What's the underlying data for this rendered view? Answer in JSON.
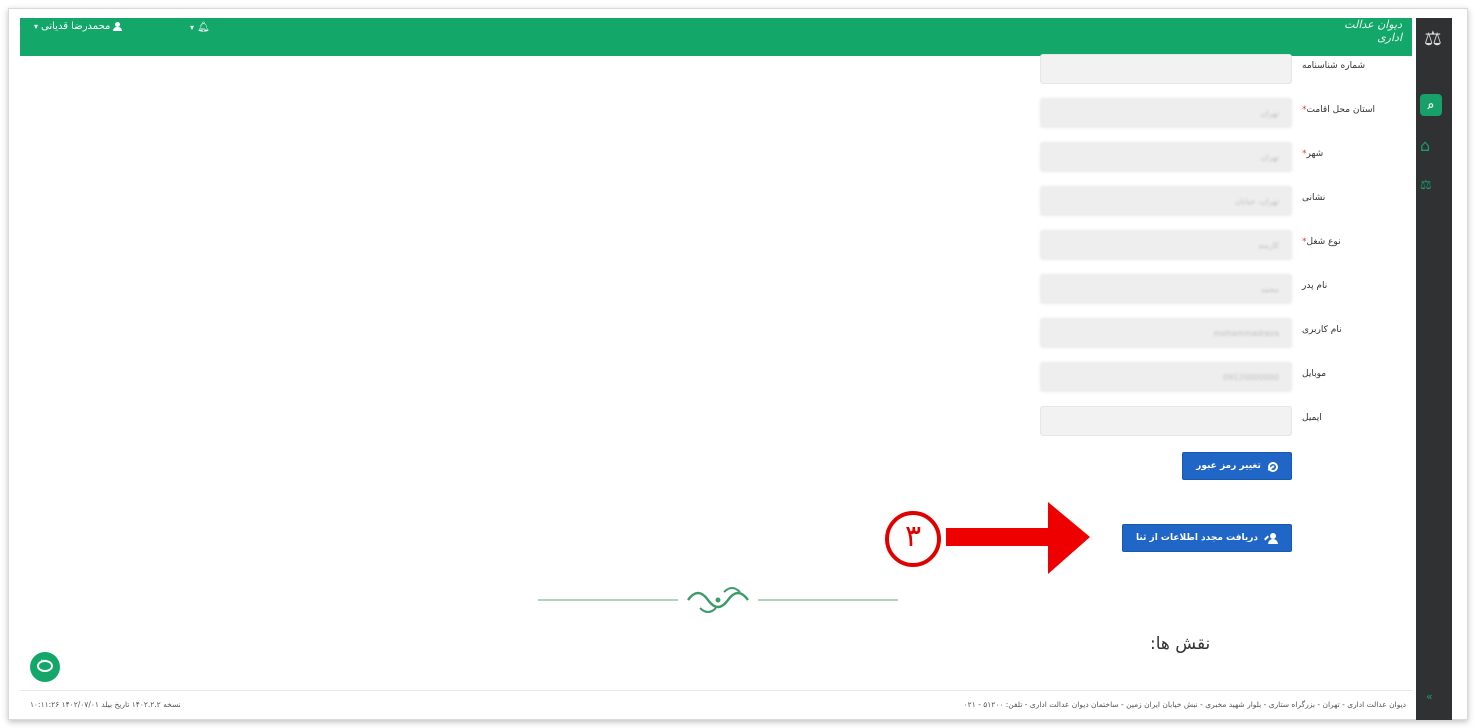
{
  "header": {
    "user_name": "محمدرضا قدیانی",
    "logo_text": "دیوان عدالت اداری"
  },
  "form": {
    "fields": [
      {
        "label": "شماره شناسنامه",
        "required": false,
        "value": ""
      },
      {
        "label": "استان محل اقامت",
        "required": true,
        "value": "تهران"
      },
      {
        "label": "شهر",
        "required": true,
        "value": "تهران"
      },
      {
        "label": "نشانی",
        "required": false,
        "value": "تهران، خیابان"
      },
      {
        "label": "نوع شغل",
        "required": true,
        "value": "کارمند"
      },
      {
        "label": "نام پدر",
        "required": false,
        "value": "محمد"
      },
      {
        "label": "نام کاربری",
        "required": false,
        "value": "mohammadreza"
      },
      {
        "label": "موبایل",
        "required": false,
        "value": "09120000000"
      },
      {
        "label": "ایمیل",
        "required": false,
        "value": ""
      }
    ],
    "change_password_label": "تغییر رمز عبور",
    "refresh_info_label": "دریافت مجدد اطلاعات از ثنا"
  },
  "annotation": {
    "step_number": "۳"
  },
  "roles": {
    "title": "نقش ها:"
  },
  "footer": {
    "address": "دیوان عدالت اداری - تهران - بزرگراه ستاری - بلوار شهید مخبری - نبش خیابان ایران زمین - ساختمان دیوان عدالت اداری - تلفن: ۵۱۲۰۰ - ۰۲۱",
    "version": "نسخه ۱۴۰۲.۲.۲ تاریخ بیلد ۱۴۰۲/۰۷/۰۱ ۱۰:۱۱:۲۶"
  },
  "colors": {
    "brand_green": "#14a76a",
    "button_blue": "#1f66c7",
    "annotation_red": "#e00000",
    "sidebar_dark": "#2f3133"
  },
  "icons": {
    "user": "user-icon",
    "bell": "bell-icon",
    "search": "search-icon",
    "home": "home-icon",
    "balance": "scale-icon",
    "key": "key-icon",
    "user_edit": "user-edit-icon",
    "chat": "chat-icon"
  }
}
